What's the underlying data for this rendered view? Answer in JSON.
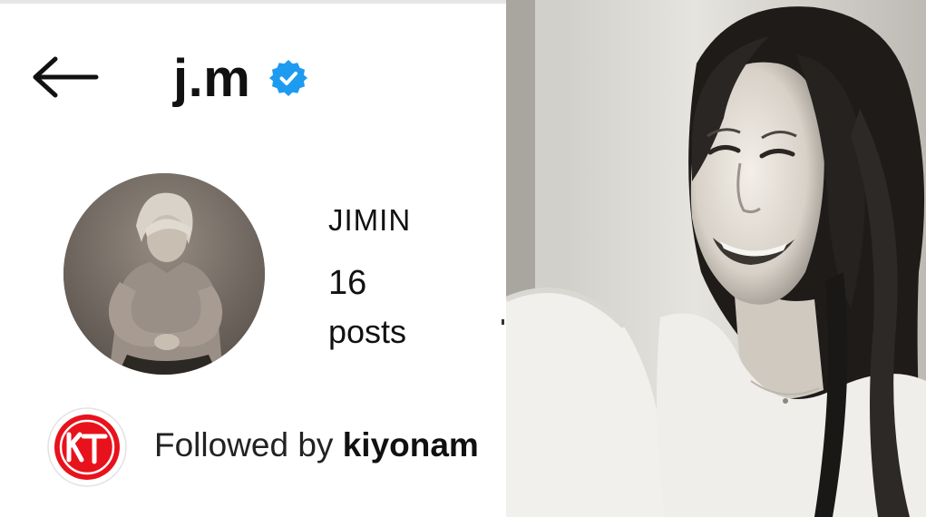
{
  "header": {
    "back_icon": "arrow-left-icon",
    "username": "j.m",
    "verified_icon": "verified-badge-icon",
    "verified_color": "#1d9bf0"
  },
  "profile": {
    "display_name": "JIMIN",
    "post_count": "16",
    "post_label": "posts"
  },
  "followed_by": {
    "prefix": "Followed by",
    "name": "kiyonam",
    "avatar_logo_text": "KT",
    "avatar_color": "#e8121c"
  }
}
